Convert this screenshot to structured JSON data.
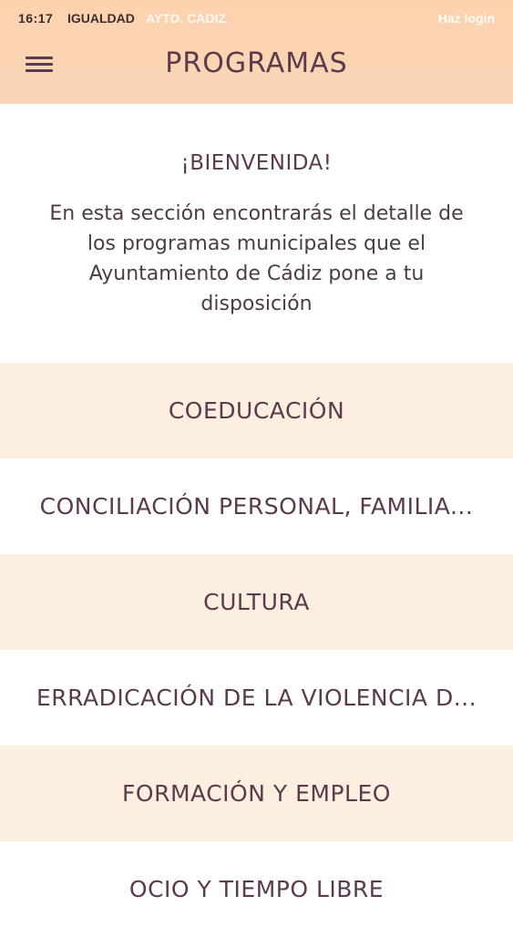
{
  "status_bar": {
    "time": "16:17",
    "app_name": "IGUALDAD",
    "org_name": "AYTO. CÁDIZ",
    "login_label": "Haz login"
  },
  "header": {
    "title": "PROGRAMAS",
    "menu_icon": "hamburger-menu-icon"
  },
  "intro": {
    "title": "¡BIENVENIDA!",
    "text": "En esta sección encontrarás el detalle de los programas municipales que el Ayuntamiento de Cádiz pone a tu disposición"
  },
  "programs": [
    {
      "label": "COEDUCACIÓN"
    },
    {
      "label": "CONCILIACIÓN PERSONAL, FAMILIA..."
    },
    {
      "label": "CULTURA"
    },
    {
      "label": "ERRADICACIÓN DE LA VIOLENCIA D..."
    },
    {
      "label": "FORMACIÓN Y EMPLEO"
    },
    {
      "label": "OCIO Y TIEMPO LIBRE"
    }
  ],
  "colors": {
    "header_bg": "#fcd2ae",
    "row_shade": "#fdefe0",
    "text": "#5a3b4e"
  }
}
